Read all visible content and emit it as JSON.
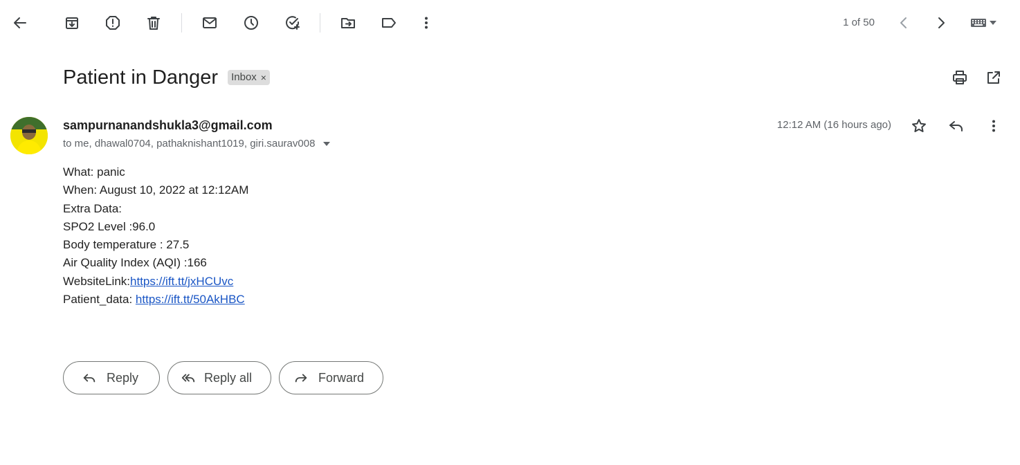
{
  "toolbar": {
    "icons": [
      "back-arrow-icon",
      "archive-icon",
      "report-spam-icon",
      "delete-icon",
      "mark-unread-icon",
      "snooze-icon",
      "add-to-tasks-icon",
      "move-to-icon",
      "label-icon",
      "more-vert-icon"
    ],
    "pager": "1 of 50"
  },
  "email": {
    "subject": "Patient in Danger",
    "label": "Inbox",
    "label_close": "×",
    "sender": "sampurnanandshukla3@gmail.com",
    "recipients": "to me, dhawal0704, pathaknishant1019, giri.saurav008",
    "timestamp": "12:12 AM (16 hours ago)",
    "body": {
      "what": "What: panic",
      "when": "When: August 10, 2022 at 12:12AM",
      "extra": "Extra Data:",
      "spo2": "SPO2 Level :96.0",
      "temperature": "Body temperature : 27.5",
      "aqi": "Air Quality Index (AQI) :166",
      "website_prefix": "WebsiteLink:",
      "website_link": "https://ift.tt/jxHCUvc",
      "patient_prefix": "Patient_data: ",
      "patient_link": "https://ift.tt/50AkHBC"
    }
  },
  "actions": {
    "reply": "Reply",
    "reply_all": "Reply all",
    "forward": "Forward"
  },
  "colors": {
    "link": "#1a56c5",
    "label_chip": "#dddddd",
    "avatar_bg": "#f5e000"
  }
}
